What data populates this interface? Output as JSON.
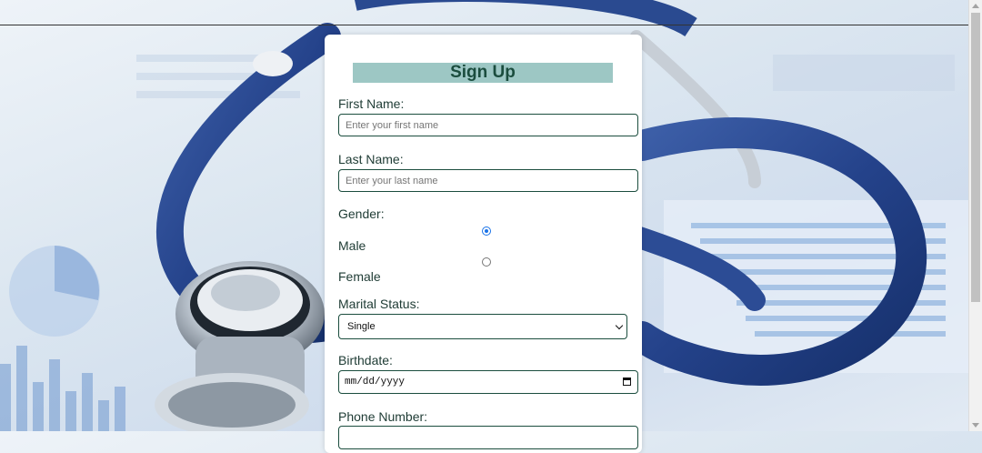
{
  "form": {
    "title": "Sign Up",
    "first_name": {
      "label": "First Name:",
      "placeholder": "Enter your first name",
      "value": ""
    },
    "last_name": {
      "label": "Last Name:",
      "placeholder": "Enter your last name",
      "value": ""
    },
    "gender": {
      "label": "Gender:",
      "options": [
        {
          "label": "Male",
          "checked": true
        },
        {
          "label": "Female",
          "checked": false
        }
      ]
    },
    "marital_status": {
      "label": "Marital Status:",
      "selected": "Single"
    },
    "birthdate": {
      "label": "Birthdate:",
      "placeholder": "mm/dd/yyyy"
    },
    "phone": {
      "label": "Phone Number:"
    }
  },
  "colors": {
    "title_bg": "#9dc7c4",
    "title_text": "#1b4d3e",
    "border": "#1b4d3e",
    "radio_checked": "#1a73e8"
  },
  "icons": {
    "birthdate": "calendar-icon",
    "select": "chevron-down-icon"
  }
}
